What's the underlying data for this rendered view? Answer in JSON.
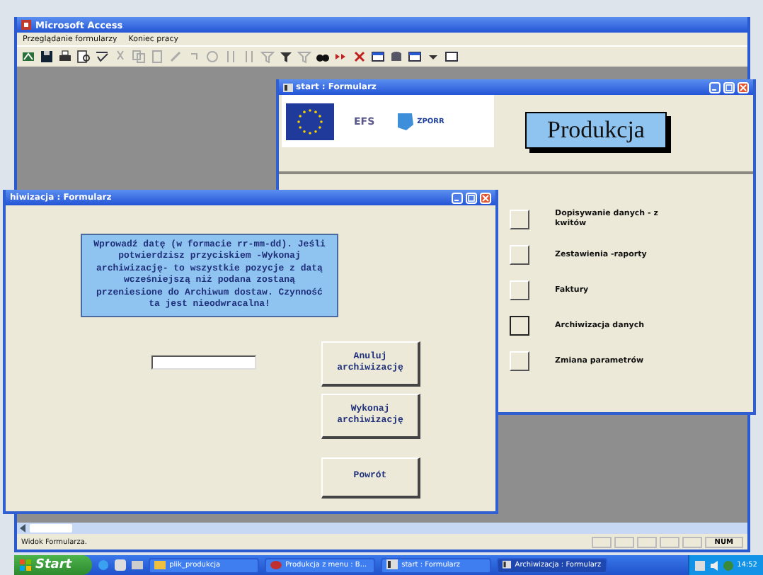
{
  "app": {
    "title": "Microsoft Access",
    "menu": [
      "Przeglądanie formularzy",
      "Koniec pracy"
    ]
  },
  "start_form": {
    "title": "start : Formularz",
    "logos": [
      "EFS",
      "ZPORR"
    ],
    "heading": "Produkcja",
    "options": [
      {
        "label": "Dopisywanie danych - z kwitów",
        "selected": false
      },
      {
        "label": "Zestawienia -raporty",
        "selected": false
      },
      {
        "label": "Faktury",
        "selected": false
      },
      {
        "label": "Archiwizacja danych",
        "selected": true
      },
      {
        "label": "Zmiana parametrów",
        "selected": false
      }
    ]
  },
  "archive_form": {
    "title": "hiwizacja : Formularz",
    "message": "Wprowadź datę (w formacie rr-mm-dd). Jeśli potwierdzisz przyciskiem -Wykonaj archiwizację- to wszystkie pozycje z datą wcześniejszą niż podana zostaną przeniesione do Archiwum dostaw. Czynność ta jest nieodwracalna!",
    "buttons": [
      "Anuluj archiwizację",
      "Wykonaj archiwizację",
      "Powrót"
    ]
  },
  "status_bar": {
    "text": "Widok Formularza.",
    "indicators": [
      "NUM"
    ]
  },
  "taskbar": {
    "start": "Start",
    "items": [
      {
        "label": "plik_produkcja",
        "kind": "folder",
        "selected": false
      },
      {
        "label": "Produkcja z menu : B...",
        "kind": "database",
        "selected": false
      },
      {
        "label": "start : Formularz",
        "kind": "form",
        "selected": false
      },
      {
        "label": "Archiwizacja : Formularz",
        "kind": "form",
        "selected": true
      }
    ],
    "clock": "14:52"
  }
}
